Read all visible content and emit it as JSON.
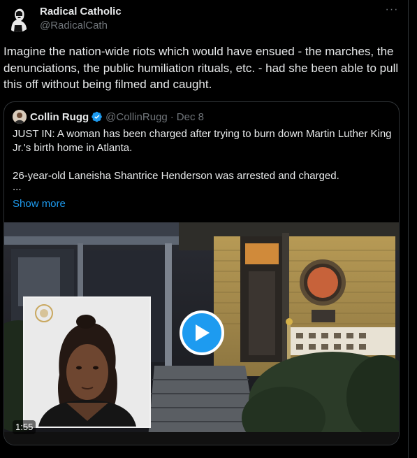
{
  "author": {
    "name": "Radical Catholic",
    "handle": "@RadicalCath"
  },
  "more_menu": "···",
  "tweet_text": "Imagine the nation-wide riots which would have ensued - the marches, the denunciations, the public humiliation rituals, etc. - had she been able to pull this off without being filmed and caught.",
  "quoted": {
    "name": "Collin Rugg",
    "handle": "@CollinRugg",
    "separator": "·",
    "date": "Dec 8",
    "line1": "JUST IN: A woman has been charged after trying to burn down Martin Luther King Jr.'s birth home in Atlanta.",
    "line2": "26-year-old Laneisha Shantrice Henderson was arrested and charged.",
    "ellipsis": "...",
    "show_more": "Show more",
    "video": {
      "duration": "1:55"
    }
  },
  "colors": {
    "background": "#000000",
    "text": "#e7e9ea",
    "muted": "#71767b",
    "accent": "#1d9bf0",
    "border": "#2f3336"
  },
  "icons": {
    "verified": "verified-badge-icon",
    "play": "play-icon",
    "more": "more-icon"
  }
}
